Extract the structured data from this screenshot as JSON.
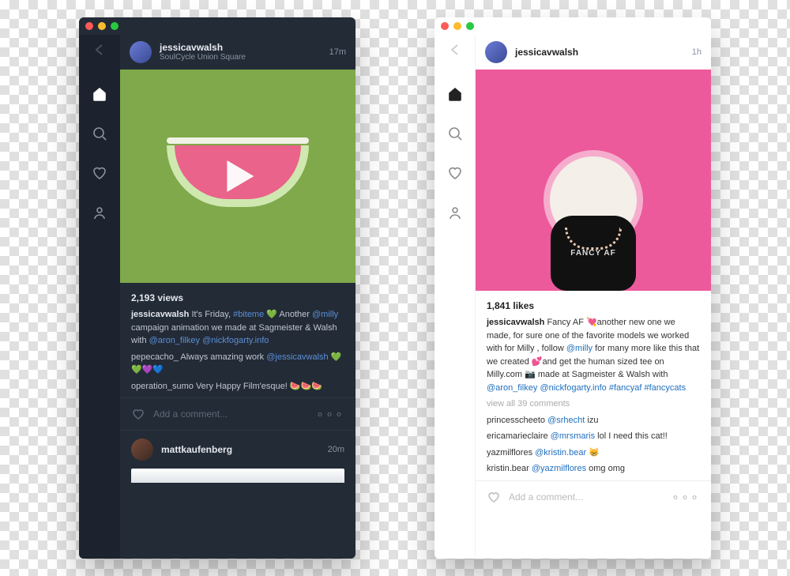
{
  "windows": [
    {
      "theme": "dark",
      "sidebar": {
        "back": "←"
      },
      "post": {
        "username": "jessicavwalsh",
        "location": "SoulCycle Union Square",
        "time": "17m",
        "views": "2,193 views",
        "caption_user": "jessicavwalsh",
        "caption_t1": " It's Friday, ",
        "caption_l1": "#biteme",
        "caption_t2": " 💚 Another ",
        "caption_l2": "@milly",
        "caption_t3": " campaign animation we made at Sagmeister & Walsh with ",
        "caption_l3": "@aron_filkey",
        "caption_t4": " ",
        "caption_l4": "@nickfogarty.info",
        "comments": [
          {
            "user": "pepecacho_",
            "t1": " Always amazing work ",
            "l1": "@jessicavwalsh",
            "t2": " 💚💚💜💙"
          },
          {
            "user": "operation_sumo",
            "t1": " Very Happy Film'esque! 🍉🍉🍉"
          }
        ],
        "add_comment_placeholder": "Add a comment..."
      },
      "next_post": {
        "username": "mattkaufenberg",
        "time": "20m"
      }
    },
    {
      "theme": "light",
      "post": {
        "username": "jessicavwalsh",
        "time": "1h",
        "likes": "1,841 likes",
        "shirt_text": "FANCY\nAF",
        "caption_user": "jessicavwalsh",
        "caption_t1": " Fancy AF 💘another new one we made, for sure one of the favorite models we worked with for Milly , follow ",
        "caption_l1": "@milly",
        "caption_t2": " for many more like this that we created 💕and get the human sized tee on Milly.com 📷 made at Sagmeister & Walsh with ",
        "caption_l2": "@aron_filkey",
        "caption_t3": " ",
        "caption_l3": "@nickfogarty.info",
        "caption_t4": " ",
        "caption_l4": "#fancyaf",
        "caption_t5": " ",
        "caption_l5": "#fancycats",
        "view_all": "view all 39 comments",
        "comments": [
          {
            "user": "princesscheeto",
            "t1": " ",
            "l1": "@srhecht",
            "t2": " izu"
          },
          {
            "user": "ericamarieclaire",
            "t1": " ",
            "l1": "@mrsmaris",
            "t2": " lol I need this cat!!"
          },
          {
            "user": "yazmilflores",
            "t1": " ",
            "l1": "@kristin.bear",
            "t2": " 😸"
          },
          {
            "user": "kristin.bear",
            "t1": " ",
            "l1": "@yazmilflores",
            "t2": " omg omg"
          }
        ],
        "add_comment_placeholder": "Add a comment..."
      }
    }
  ]
}
